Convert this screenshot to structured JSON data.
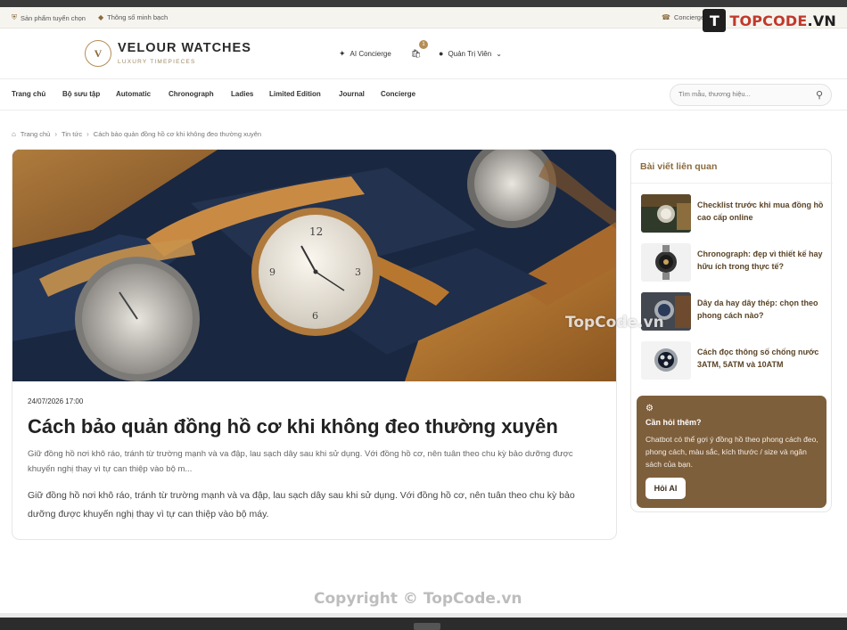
{
  "utility": {
    "item1": "Sản phẩm tuyển chọn",
    "item2": "Thông số minh bạch",
    "concierge": "Concierge 090"
  },
  "watermark": {
    "logo_text_red": "TOPCODE",
    "logo_text_dark": ".VN",
    "center": "TopCode.vn",
    "copyright": "Copyright © TopCode.vn"
  },
  "header": {
    "logo_mark": "V",
    "brand": "VELOUR WATCHES",
    "tagline": "LUXURY TIMEPIECES",
    "ai_concierge": "AI Concierge",
    "cart_count": "1",
    "account": "Quản Trị Viên"
  },
  "nav": {
    "items": [
      "Trang chủ",
      "Bộ sưu tập",
      "Automatic",
      "Chronograph",
      "Ladies",
      "Limited Edition",
      "Journal",
      "Concierge"
    ],
    "search_placeholder": "Tìm mẫu, thương hiệu..."
  },
  "breadcrumb": {
    "home": "Trang chủ",
    "news": "Tin tức",
    "current": "Cách bảo quản đồng hồ cơ khi không đeo thường xuyên"
  },
  "post": {
    "date": "24/07/2026 17:00",
    "title": "Cách bảo quản đồng hồ cơ khi không đeo thường xuyên",
    "excerpt": "Giữ đồng hồ nơi khô ráo, tránh từ trường mạnh và va đập, lau sạch dây sau khi sử dụng. Với đồng hồ cơ, nên tuân theo chu kỳ bảo dưỡng được khuyến nghị thay vì tự can thiệp vào bộ m...",
    "body": "Giữ đồng hồ nơi khô ráo, tránh từ trường mạnh và va đập, lau sạch dây sau khi sử dụng. Với đồng hồ cơ, nên tuân theo chu kỳ bảo dưỡng được khuyến nghị thay vì tự can thiệp vào bộ máy."
  },
  "sidebar": {
    "title": "Bài viết liên quan",
    "related": [
      "Checklist trước khi mua đồng hồ cao cấp online",
      "Chronograph: đẹp vì thiết kế hay hữu ích trong thực tế?",
      "Dây da hay dây thép: chọn theo phong cách nào?",
      "Cách đọc thông số chống nước 3ATM, 5ATM và 10ATM"
    ],
    "ask": {
      "title": "Cần hỏi thêm?",
      "text": "Chatbot có thể gợi ý đồng hồ theo phong cách đeo, phong cách, màu sắc, kích thước / size và ngân sách của bạn.",
      "button": "Hỏi AI"
    }
  },
  "colors": {
    "accent": "#8a6a3b",
    "card_brown": "#7e5f3c"
  }
}
